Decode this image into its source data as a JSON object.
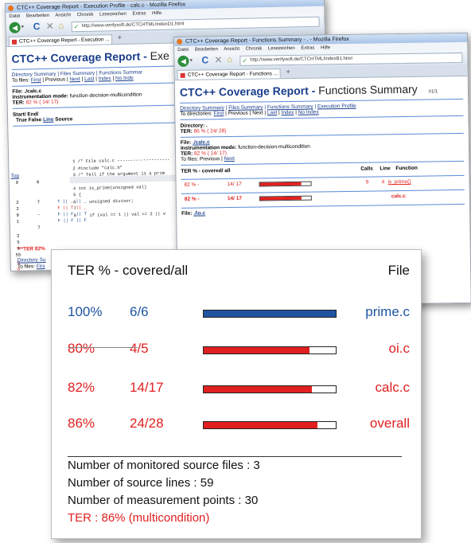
{
  "colors": {
    "blue": "#1f55a0",
    "red": "#e02020",
    "link": "#1a3d8a"
  },
  "back_window": {
    "title": "CTC++ Coverage Report - Execution Profile - calc.c - Mozilla Firefox",
    "menu": [
      "Datei",
      "Bearbeiten",
      "Ansicht",
      "Chronik",
      "Lesezeichen",
      "Extras",
      "Hilfe"
    ],
    "url": "http://www.verifysoft.de/CTCHTML/indexD1.html",
    "tab": "CTC++ Coverage Report - Execution ...",
    "heading": "CTC++ Coverage Report -",
    "heading_sub": "Exe",
    "nav_links": "Directory Summary | Files Summary | Functions Summar",
    "to_files": "To files:",
    "first": "First",
    "previous": "| Previous |",
    "next": "Next",
    "last": "Last",
    "index": "Index",
    "no_index": "No Inde",
    "file_label": "File: ./calc.c",
    "mode_label": "Instrumentation mode:",
    "mode_value": "function-decision-multicondition",
    "ter_label": "TER:",
    "ter_value": "82 % ( 14/ 17)",
    "col_startend": "Start/  End/",
    "col_true": "True",
    "col_false": "False",
    "col_line": "Line",
    "col_source": "Source",
    "top_link": "Top",
    "code_lines": [
      "1 /* File calc.c --------------------",
      "2 #include \"calc.h\"",
      "3 /* Tell if the argument is a prim",
      "",
      "4 int is_prime(unsigned val)",
      "5 {",
      "6     unsigned divisor;",
      "7",
      "8     if (val == 1 || val == 2 || v"
    ],
    "left_counts": [
      {
        "a": "9",
        "b": "0"
      },
      {
        "a": "2",
        "b": "7"
      },
      {
        "a": "2",
        "b": ""
      },
      {
        "a": "0",
        "b": "-"
      },
      {
        "a": "1",
        "b": ""
      },
      {
        "a": "",
        "b": "7"
      }
    ],
    "cond_rows": [
      "T || _ || _",
      "F || T || _",
      "F || F || T",
      "F || F || F"
    ],
    "extra_counts": [
      "2",
      "5",
      "3",
      "55",
      "0",
      "0",
      "2"
    ],
    "ter_footer": "***TER 82%",
    "dir_summary": "Directory Su",
    "to_files_footer": "To files:",
    "first_footer": "Firs"
  },
  "front_window": {
    "title": "CTC++ Coverage Report - Functions Summary - . - Mozilla Firefox",
    "menu": [
      "Datei",
      "Bearbeiten",
      "Ansicht",
      "Chronik",
      "Lesezeichen",
      "Extras",
      "Hilfe"
    ],
    "url": "http://www.verifysoft.de/CTCHTML/indexB1.html",
    "tab": "CTC++ Coverage Report - Functions ...",
    "heading": "CTC++ Coverage Report -",
    "heading_sub": "Functions Summary",
    "page_num": "#1/1",
    "nav_links": [
      "Directory Summary",
      "Files Summary",
      "Functions Summary",
      "Execution Profile"
    ],
    "to_dirs": "To directories:",
    "first": "First",
    "previous": "Previous",
    "next": "Next",
    "last": "Last",
    "index": "Index",
    "no_index": "No Index",
    "directory_label": "Directory: .",
    "dir_ter_label": "TER:",
    "dir_ter_value": "86 % ( 24/ 28)",
    "file_label": "File:",
    "file_name": "./calc.c",
    "mode_label": "Instrumentation mode:",
    "mode_value": "function-decision-multicondition",
    "ter_label": "TER:",
    "ter_value": "82 % ( 14/ 17)",
    "to_files": "To files: Previous |",
    "to_files_next": "Next",
    "table_header": {
      "ter": "TER %  -  covered/ all",
      "calls": "Calls",
      "line": "Line",
      "function": "Function"
    },
    "rows": [
      {
        "ter": "82 %  -",
        "cov": "14/ 17",
        "fill": 0.82,
        "calls": "9",
        "line": "4",
        "func": "is_prime()"
      },
      {
        "ter": "82 %  -",
        "cov": "14/ 17",
        "fill": 0.82,
        "calls": "",
        "line": "",
        "func": "calc.c"
      }
    ],
    "file2_label": "File:",
    "file2_name": "./io.c"
  },
  "summary_panel": {
    "header_ter": "TER % - covered/all",
    "header_file": "File",
    "rows": [
      {
        "pct": "100%",
        "cov": "6/6",
        "file": "prime.c",
        "fill": 1.0,
        "color": "#1f55a0"
      },
      {
        "pct": "80%",
        "cov": "4/5",
        "file": "oi.c",
        "fill": 0.8,
        "color": "#e02020"
      },
      {
        "pct": "82%",
        "cov": "14/17",
        "file": "calc.c",
        "fill": 0.82,
        "color": "#e02020"
      },
      {
        "pct": "86%",
        "cov": "24/28",
        "file": "overall",
        "fill": 0.86,
        "color": "#e02020"
      }
    ],
    "stats": [
      "Number of monitored source files : 3",
      "Number of source lines : 59",
      "Number of measurement points : 30"
    ],
    "ter_total": "TER : 86% (multicondition)"
  }
}
